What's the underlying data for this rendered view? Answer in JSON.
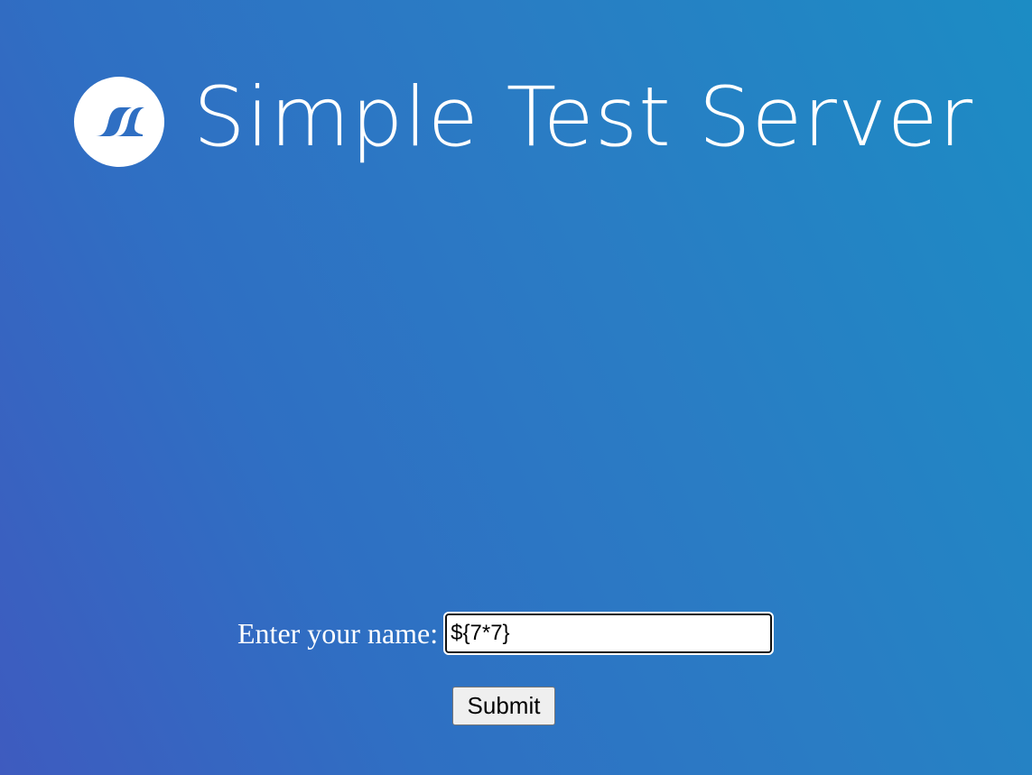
{
  "header": {
    "logo_icon": "wave-logo-icon",
    "title": "Simple Test Server"
  },
  "form": {
    "label": "Enter your name:",
    "input_value": "${7*7}",
    "submit_label": "Submit"
  },
  "colors": {
    "background_start": "#3e5bbf",
    "background_end": "#1c8cc4",
    "logo_mark": "#2f6fc3"
  }
}
